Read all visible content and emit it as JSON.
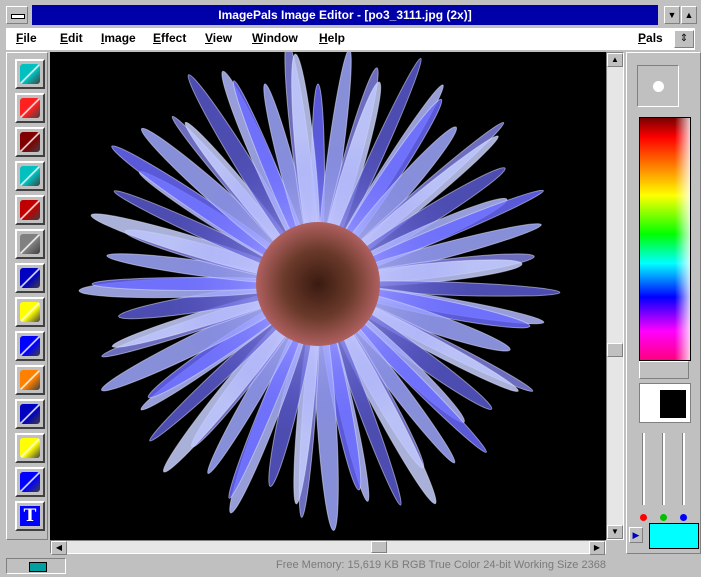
{
  "window": {
    "title": "ImagePals Image Editor - [po3_3111.jpg (2x)]"
  },
  "menu": {
    "file": "File",
    "edit": "Edit",
    "image": "Image",
    "effect": "Effect",
    "view": "View",
    "window": "Window",
    "help": "Help",
    "pals": "Pals"
  },
  "tools": [
    {
      "name": "magic-wand-tool-icon",
      "color": "#00c0c0"
    },
    {
      "name": "lasso-tool-icon",
      "color": "#ff2020"
    },
    {
      "name": "crop-tool-icon",
      "color": "#800000"
    },
    {
      "name": "fill-bucket-tool-icon",
      "color": "#00c0c0"
    },
    {
      "name": "stamp-tool-icon",
      "color": "#c00000"
    },
    {
      "name": "eyedropper-tool-icon",
      "color": "#808080"
    },
    {
      "name": "zoom-tool-icon",
      "color": "#0000c0"
    },
    {
      "name": "sparkle-tool-icon",
      "color": "#ffff00"
    },
    {
      "name": "smudge-tool-icon",
      "color": "#0000ff"
    },
    {
      "name": "brush-tool-icon",
      "color": "#ff8000"
    },
    {
      "name": "spray-tool-icon",
      "color": "#0000c0"
    },
    {
      "name": "pencil-tool-icon",
      "color": "#ffff00"
    },
    {
      "name": "paint-brush-tool-icon",
      "color": "#0000ff"
    },
    {
      "name": "text-tool-icon",
      "color": "#0000ff"
    }
  ],
  "palette": {
    "foreground": "#ffffff",
    "background": "#000000",
    "current_color": "#00ffff"
  },
  "status": {
    "text": "Free Memory: 15,619 KB  RGB True Color 24-bit  Working Size 2368"
  }
}
